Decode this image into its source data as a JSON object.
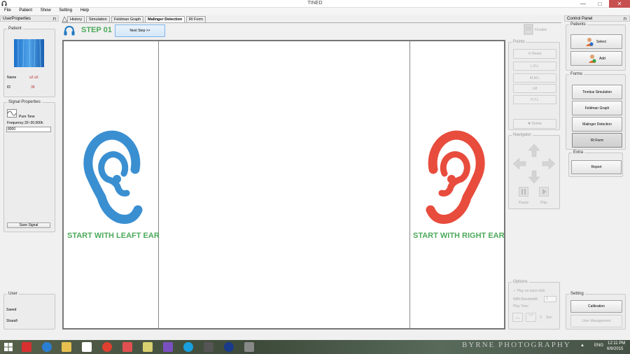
{
  "window": {
    "title": "TINED",
    "min": "—",
    "max": "□",
    "close": "✕"
  },
  "menu": [
    "File",
    "Patient",
    "Show",
    "Setting",
    "Help"
  ],
  "left_panel": {
    "header": "UserProperties",
    "patient": {
      "title": "Patient",
      "name_label": "Name",
      "name_value": "a3 a3",
      "id_label": "ID",
      "id_value": "38"
    },
    "signal": {
      "title": "Signal Properties",
      "tone": "Pure Tone",
      "freq_label": "Frequency 20~20.000h",
      "freq_value": "8000",
      "save": "Save Signal"
    },
    "user": {
      "title": "User",
      "first": "Saeed",
      "last": "Sharafi"
    }
  },
  "tabs": [
    "History",
    "Simulation",
    "Feldman Graph",
    "Malinger Detection",
    "RI Form"
  ],
  "active_tab": "Malinger Detection",
  "main": {
    "step": "STEP 01",
    "next": "Next Step >>",
    "left_text": "START WITH LEAFT EAR",
    "right_text": "START WITH RIGHT EAR",
    "left_color": "#3a8fd1",
    "right_color": "#e84c3d"
  },
  "points": {
    "title": "Points",
    "finalize": "Finalize",
    "reset": "Reset",
    "items": [
      "L.D.L",
      "M.M.L",
      "LM",
      "H.T.L"
    ],
    "delete": "Delete"
  },
  "navigator": {
    "title": "Navigator",
    "pause": "Pause",
    "play": "Play"
  },
  "options": {
    "title": "Options",
    "play_each": "Play on each click",
    "nbn_label": "NBN Bandwidth",
    "nbn_value": "1",
    "play_time": "Play Time",
    "seconds": "3",
    "sec_label": "Sec."
  },
  "control_panel": {
    "header": "Control Panel",
    "patients": {
      "title": "Patients",
      "select": "Select",
      "add": "Add"
    },
    "forms": {
      "title": "Forms",
      "items": [
        "Tinnitus Simulation",
        "Feldman Graph",
        "Malinger Detection",
        "RI Form"
      ]
    },
    "extra": {
      "title": "Extra",
      "report": "Report"
    },
    "setting": {
      "title": "Setting",
      "calibration": "Calibration",
      "user_management": "User Management"
    }
  },
  "taskbar": {
    "lang": "ENG",
    "time": "12:11 PM",
    "date": "6/9/2015",
    "wallpaper_text": "BYRNE  PHOTOGRAPHY"
  }
}
